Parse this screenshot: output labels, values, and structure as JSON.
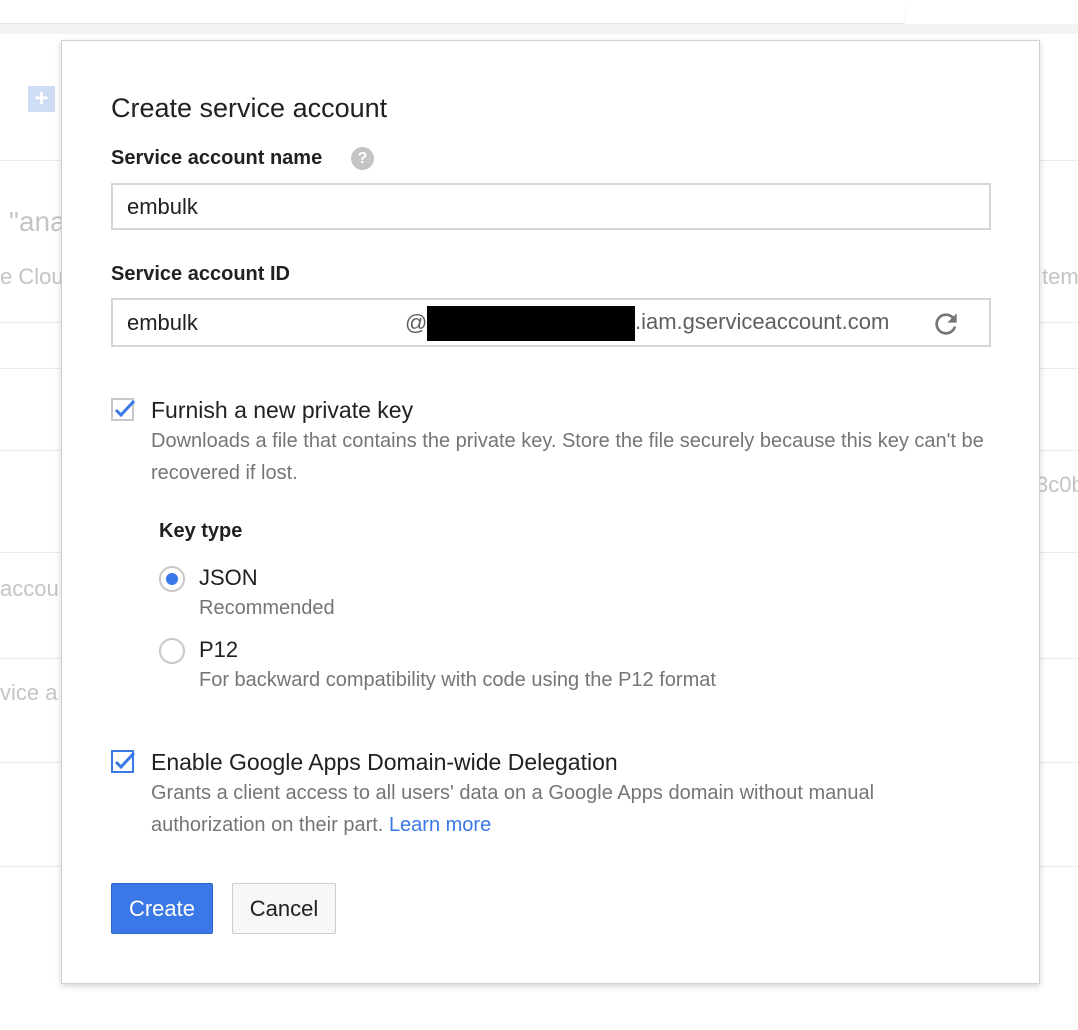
{
  "background": {
    "fragments": [
      "\"ana",
      "e Clou",
      "tem",
      "3c0b",
      "accou",
      "vice a"
    ]
  },
  "dialog": {
    "title": "Create service account",
    "name_field": {
      "label": "Service account name",
      "value": "embulk"
    },
    "id_field": {
      "label": "Service account ID",
      "value": "embulk",
      "at_sign": "@",
      "domain_suffix": ".iam.gserviceaccount.com"
    },
    "private_key": {
      "checked": true,
      "label": "Furnish a new private key",
      "description": "Downloads a file that contains the private key. Store the file securely because this key can't be recovered if lost."
    },
    "key_type": {
      "label": "Key type",
      "options": [
        {
          "label": "JSON",
          "description": "Recommended",
          "selected": true
        },
        {
          "label": "P12",
          "description": "For backward compatibility with code using the P12 format",
          "selected": false
        }
      ]
    },
    "delegation": {
      "checked": true,
      "label": "Enable Google Apps Domain-wide Delegation",
      "description": "Grants a client access to all users' data on a Google Apps domain without manual authorization on their part.",
      "link": "Learn more"
    },
    "buttons": {
      "create": "Create",
      "cancel": "Cancel"
    }
  },
  "icons": {
    "help": "help-icon",
    "refresh": "refresh-icon",
    "checkbox": "checkbox-checked-icon"
  },
  "colors": {
    "accent": "#3b78e7",
    "secondary_text": "#757575",
    "border": "#d6d6d6"
  }
}
